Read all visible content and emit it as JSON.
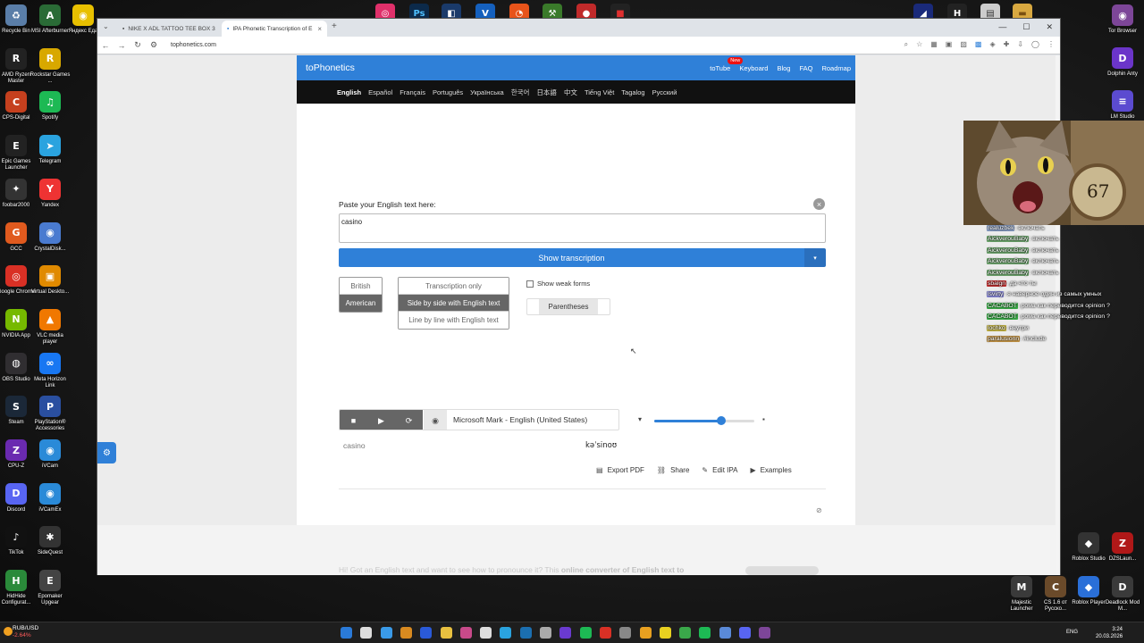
{
  "desktop_left": [
    {
      "label": "Recycle Bin",
      "icon": "recycle-bin-icon",
      "color": "#5a7ea8",
      "glyph": "♻"
    },
    {
      "label": "MSI Afterburner",
      "icon": "msi-afterburner-icon",
      "color": "#2a6b36",
      "glyph": "A"
    },
    {
      "label": "AMD Ryzen Master",
      "icon": "amd-ryzen-master-icon",
      "color": "#222",
      "glyph": "R"
    },
    {
      "label": "Rockstar Games ...",
      "icon": "rockstar-games-icon",
      "color": "#d8a800",
      "glyph": "R"
    },
    {
      "label": "CPS-Digital",
      "icon": "cps-digital-icon",
      "color": "#c5401e",
      "glyph": "C"
    },
    {
      "label": "Spotify",
      "icon": "spotify-icon",
      "color": "#1db954",
      "glyph": "♫"
    },
    {
      "label": "Epic Games Launcher",
      "icon": "epic-games-icon",
      "color": "#222",
      "glyph": "E"
    },
    {
      "label": "Telegram",
      "icon": "telegram-icon",
      "color": "#2aa3df",
      "glyph": "➤"
    },
    {
      "label": "foobar2000",
      "icon": "foobar2000-icon",
      "color": "#333",
      "glyph": "✦"
    },
    {
      "label": "Yandex",
      "icon": "yandex-icon",
      "color": "#e33",
      "glyph": "Y"
    },
    {
      "label": "GCC",
      "icon": "gcc-icon",
      "color": "#e05a1e",
      "glyph": "G"
    },
    {
      "label": "CrystalDisk...",
      "icon": "crystaldisk-icon",
      "color": "#4a7bd0",
      "glyph": "◉"
    },
    {
      "label": "Google Chrome",
      "icon": "chrome-icon",
      "color": "#d93025",
      "glyph": "◎"
    },
    {
      "label": "Virtual Deskto...",
      "icon": "virtual-desktop-icon",
      "color": "#e08a00",
      "glyph": "▣"
    },
    {
      "label": "NVIDIA App",
      "icon": "nvidia-icon",
      "color": "#76b900",
      "glyph": "N"
    },
    {
      "label": "VLC media player",
      "icon": "vlc-icon",
      "color": "#f07800",
      "glyph": "▲"
    },
    {
      "label": "OBS Studio",
      "icon": "obs-icon",
      "color": "#302e31",
      "glyph": "◍"
    },
    {
      "label": "Meta Horizon Link",
      "icon": "meta-horizon-icon",
      "color": "#1877f2",
      "glyph": "∞"
    },
    {
      "label": "Steam",
      "icon": "steam-icon",
      "color": "#1b2838",
      "glyph": "S"
    },
    {
      "label": "PlayStation® Accessories",
      "icon": "playstation-icon",
      "color": "#2a4fa0",
      "glyph": "P"
    },
    {
      "label": "CPU-Z",
      "icon": "cpu-z-icon",
      "color": "#6a2ab0",
      "glyph": "Z"
    },
    {
      "label": "iVCam",
      "icon": "ivcam-icon",
      "color": "#2a8ad8",
      "glyph": "◉"
    },
    {
      "label": "Discord",
      "icon": "discord-icon",
      "color": "#5865f2",
      "glyph": "D"
    },
    {
      "label": "iVCamEx",
      "icon": "ivcamex-icon",
      "color": "#2a8ad8",
      "glyph": "◉"
    },
    {
      "label": "TikTok",
      "icon": "tiktok-icon",
      "color": "#111",
      "glyph": "♪"
    },
    {
      "label": "SideQuest",
      "icon": "sidequest-icon",
      "color": "#333",
      "glyph": "✱"
    },
    {
      "label": "HidHide Configurat...",
      "icon": "hidhide-icon",
      "color": "#2a8a3a",
      "glyph": "H"
    },
    {
      "label": "Epomaker Upgear",
      "icon": "epomaker-icon",
      "color": "#444",
      "glyph": "E"
    }
  ],
  "desktop_top": [
    {
      "icon": "yandex-browser-icon",
      "label": "Яндекс Едa",
      "color": "#e8c000",
      "glyph": "◉"
    }
  ],
  "desktop_right": [
    {
      "label": "Tor Browser",
      "icon": "tor-browser-icon",
      "color": "#7d4698",
      "glyph": "◉"
    },
    {
      "label": "Dolphin Anty",
      "icon": "dolphin-anty-icon",
      "color": "#6b35c9",
      "glyph": "D"
    },
    {
      "label": "LM Studio",
      "icon": "lm-studio-icon",
      "color": "#5b4bd0",
      "glyph": "≡"
    }
  ],
  "desktop_right_bottom": [
    {
      "label": "Roblox Studio",
      "icon": "roblox-studio-icon",
      "color": "#333",
      "glyph": "◆"
    },
    {
      "label": "DZSLaun...",
      "icon": "dzsl-icon",
      "color": "#b01818",
      "glyph": "Z"
    },
    {
      "label": "Majestic Launcher",
      "icon": "majestic-icon",
      "color": "#3a3a3a",
      "glyph": "M"
    },
    {
      "label": "CS 1.6 от Русско...",
      "icon": "cs16-icon",
      "color": "#6a4a2a",
      "glyph": "C"
    },
    {
      "label": "Roblox Player",
      "icon": "roblox-player-icon",
      "color": "#2a6fd8",
      "glyph": "◆"
    },
    {
      "label": "Deadlock Mod M...",
      "icon": "deadlock-icon",
      "color": "#3a3a3a",
      "glyph": "D"
    }
  ],
  "browser": {
    "tabs": [
      {
        "title": "NIKE X ADL TATTOO TEE BOX 3",
        "active": false
      },
      {
        "title": "IPA Phonetic Transcription of E",
        "active": true
      }
    ],
    "url": "tophonetics.com"
  },
  "site": {
    "logo": "toPhonetics",
    "nav": [
      "toTube",
      "Keyboard",
      "Blog",
      "FAQ",
      "Roadmap"
    ],
    "new_badge": "New",
    "languages": [
      "English",
      "Español",
      "Français",
      "Português",
      "Українська",
      "한국어",
      "日本語",
      "中文",
      "Tiếng Việt",
      "Tagalog",
      "Русский"
    ],
    "selected_language": "English"
  },
  "converter": {
    "prompt": "Paste your English text here:",
    "input_value": "casino",
    "show_button": "Show transcription",
    "accent_options": [
      "British",
      "American"
    ],
    "selected_accent": "American",
    "output_modes": [
      "Transcription only",
      "Side by side with English text",
      "Line by line with English text"
    ],
    "selected_mode": "Side by side with English text",
    "weak_forms": "Show weak forms",
    "parentheses": "Parentheses",
    "voice": "Microsoft Mark - English (United States)",
    "speed_fraction": 0.67,
    "result_word": "casino",
    "result_ipa": "kəˈsinoʊ",
    "actions": [
      {
        "label": "Export PDF",
        "icon": "pdf-icon",
        "glyph": "▤"
      },
      {
        "label": "Share",
        "icon": "share-icon",
        "glyph": "⛓"
      },
      {
        "label": "Edit IPA",
        "icon": "edit-icon",
        "glyph": "✎"
      },
      {
        "label": "Examples",
        "icon": "video-icon",
        "glyph": "▶"
      }
    ]
  },
  "footer_text_faded": "Hi! Got an English text and want to see how to pronounce it? This",
  "footer_text_bold": "online converter of English text to",
  "chat": [
    {
      "user": "realuzbek",
      "text": "включать",
      "color": "#8aa0c8"
    },
    {
      "user": "AickverouBaby",
      "text": "включать",
      "color": "#6fa86f"
    },
    {
      "user": "AickverouBaby",
      "text": "включать",
      "color": "#6fa86f"
    },
    {
      "user": "AickverouBaby",
      "text": "включать",
      "color": "#6fa86f"
    },
    {
      "user": "AickverouBaby",
      "text": "включать",
      "color": "#6fa86f"
    },
    {
      "user": "sbalgn",
      "text": "да что ты",
      "color": "#c83232"
    },
    {
      "user": "lsvirty",
      "text": "я наверное один из самых умных",
      "color": "#8a8ad8"
    },
    {
      "user": "CACABOT",
      "text": "рома как переводится opinion ?",
      "color": "#3cb04a"
    },
    {
      "user": "CACABOT",
      "text": "рома как переводится opinion ?",
      "color": "#3cb04a"
    },
    {
      "user": "lochko",
      "text": "внутри",
      "color": "#c8b848"
    },
    {
      "user": "paralusionn",
      "text": "#include",
      "color": "#c89848"
    }
  ],
  "taskbar": {
    "ticker_pair": "RUB/USD",
    "ticker_change": "-2.64%",
    "lang": "ENG",
    "time": "3:24",
    "date": "20.03.2026"
  }
}
